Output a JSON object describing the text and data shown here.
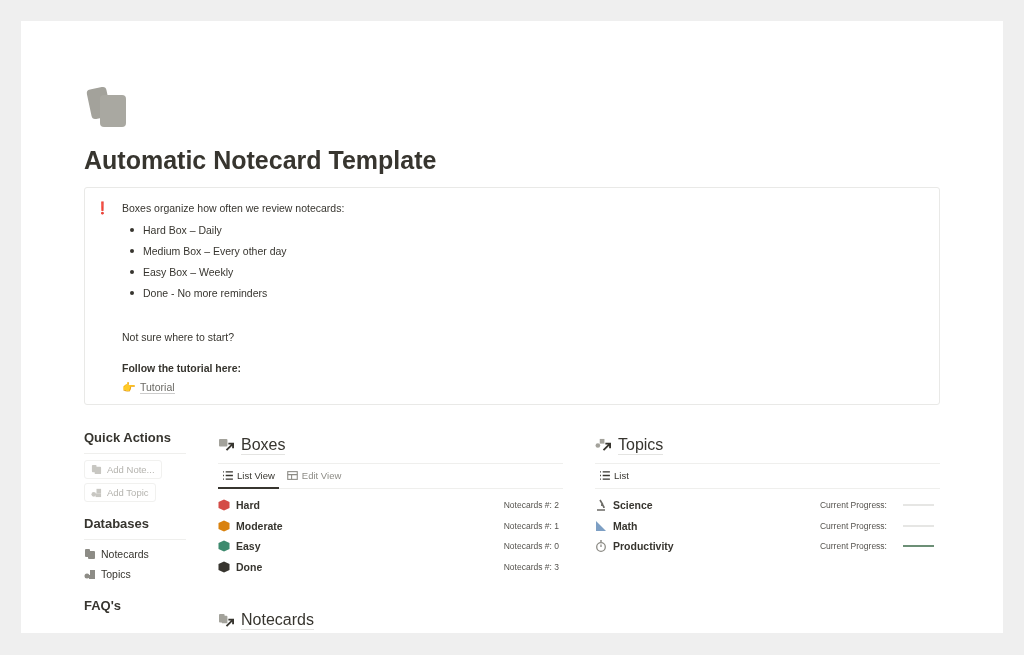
{
  "page": {
    "title": "Automatic Notecard Template"
  },
  "callout": {
    "icon": "❗",
    "intro": "Boxes organize how often we review notecards:",
    "bullets": [
      "Hard Box – Daily",
      "Medium Box – Every other day",
      "Easy Box – Weekly",
      "Done - No more reminders"
    ],
    "question": "Not sure where to start?",
    "follow": "Follow the tutorial here:",
    "link_emoji": "👉",
    "link": "Tutorial"
  },
  "sidebar": {
    "quick_actions": {
      "heading": "Quick Actions",
      "buttons": [
        {
          "label": "Add Note...",
          "kind": "cards"
        },
        {
          "label": "Add Topic",
          "kind": "shapes"
        }
      ]
    },
    "databases": {
      "heading": "Databases",
      "items": [
        {
          "label": "Notecards",
          "kind": "cards"
        },
        {
          "label": "Topics",
          "kind": "shapes"
        }
      ]
    },
    "faq": {
      "heading": "FAQ's"
    }
  },
  "boxes": {
    "title": "Boxes",
    "tabs": [
      {
        "label": "List View",
        "kind": "list",
        "selected": true
      },
      {
        "label": "Edit View",
        "kind": "table",
        "selected": false
      }
    ],
    "rows": [
      {
        "name": "Hard",
        "color": "#d44c47",
        "count": "Notecards #: 2"
      },
      {
        "name": "Moderate",
        "color": "#d9820f",
        "count": "Notecards #: 1"
      },
      {
        "name": "Easy",
        "color": "#3d8a6e",
        "count": "Notecards #: 0"
      },
      {
        "name": "Done",
        "color": "#37352f",
        "count": "Notecards #: 3"
      }
    ]
  },
  "topics": {
    "title": "Topics",
    "tabs": [
      {
        "label": "List",
        "kind": "list",
        "selected": true
      }
    ],
    "rows": [
      {
        "name": "Science",
        "kind": "microscope",
        "label": "Current Progress:",
        "level": 0
      },
      {
        "name": "Math",
        "kind": "ruler",
        "label": "Current Progress:",
        "level": 0
      },
      {
        "name": "Productivity",
        "kind": "stopwatch",
        "label": "Current Progress:",
        "level": 1
      }
    ]
  },
  "notecards": {
    "title": "Notecards"
  }
}
